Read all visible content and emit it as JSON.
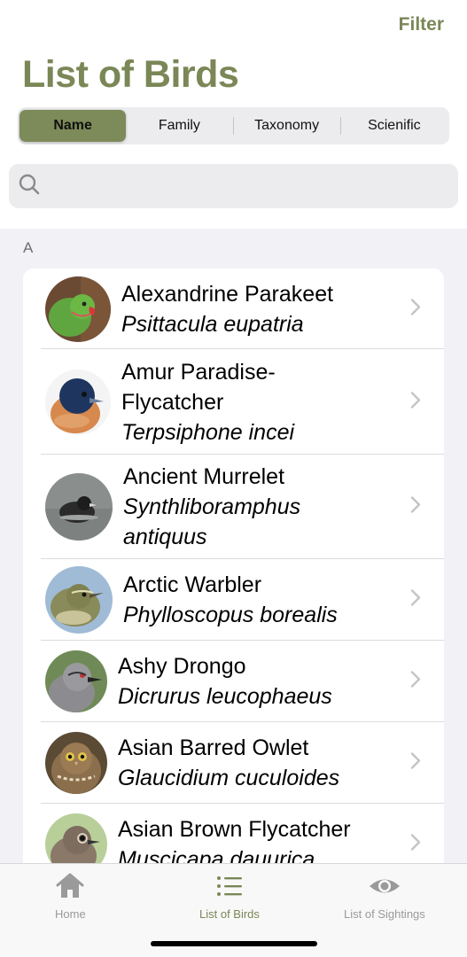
{
  "header": {
    "filter_label": "Filter",
    "title": "List of Birds"
  },
  "segmented": {
    "options": [
      "Name",
      "Family",
      "Taxonomy",
      "Scienific"
    ],
    "selected": "Name"
  },
  "search": {
    "placeholder": "",
    "icon": "search-icon"
  },
  "list": {
    "section": "A",
    "items": [
      {
        "common": "Alexandrine Parakeet",
        "scientific": "Psittacula eupatria"
      },
      {
        "common": "Amur Paradise-\nFlycatcher",
        "scientific": "Terpsiphone incei"
      },
      {
        "common": "Ancient Murrelet",
        "scientific": "Synthliboramphus\nantiquus"
      },
      {
        "common": "Arctic Warbler",
        "scientific": "Phylloscopus borealis"
      },
      {
        "common": "Ashy Drongo",
        "scientific": "Dicrurus leucophaeus"
      },
      {
        "common": "Asian Barred Owlet",
        "scientific": "Glaucidium cuculoides"
      },
      {
        "common": "Asian Brown Flycatcher",
        "scientific": "Muscicapa dauurica"
      }
    ]
  },
  "tabbar": {
    "tabs": [
      {
        "label": "Home",
        "icon": "home-icon"
      },
      {
        "label": "List of Birds",
        "icon": "list-icon"
      },
      {
        "label": "List of Sightings",
        "icon": "eye-icon"
      }
    ],
    "active": "List of Birds"
  },
  "colors": {
    "accent": "#7a8756",
    "segment_active": "#7d8a5a",
    "list_background": "#f2f2f6"
  }
}
